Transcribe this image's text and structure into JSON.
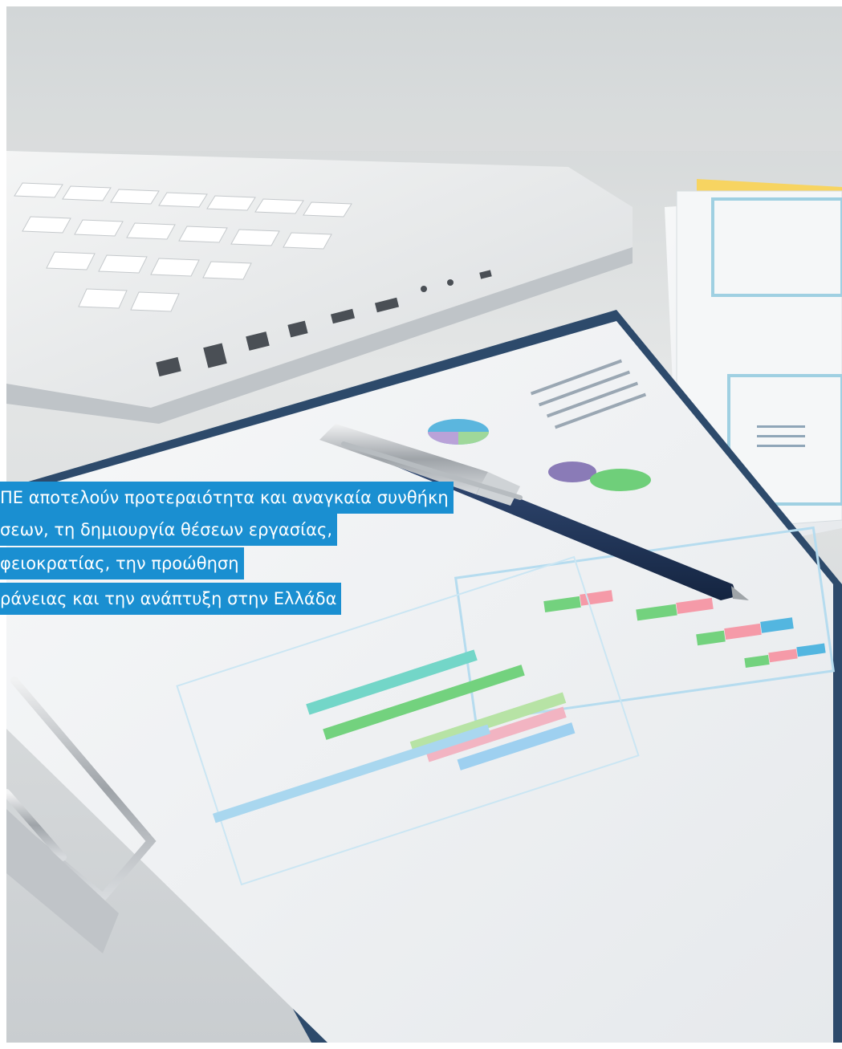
{
  "caption": {
    "line1": "ΠΕ αποτελούν προτεραιότητα και αναγκαία συνθήκη",
    "line2": "σεων, τη δημιουργία θέσεων εργασίας,",
    "line3": "φειοκρατίας, την προώθηση",
    "line4": "ράνειας και την ανάπτυξη στην Ελλάδα"
  },
  "colors": {
    "caption_background": "#1a8fd1",
    "caption_text": "#ffffff",
    "clipboard": "#2d4a6b",
    "pen_body": "#1f3458"
  },
  "icons": [
    "laptop-icon",
    "clipboard-icon",
    "pen-icon",
    "bar-chart-icon",
    "pie-chart-icon"
  ]
}
